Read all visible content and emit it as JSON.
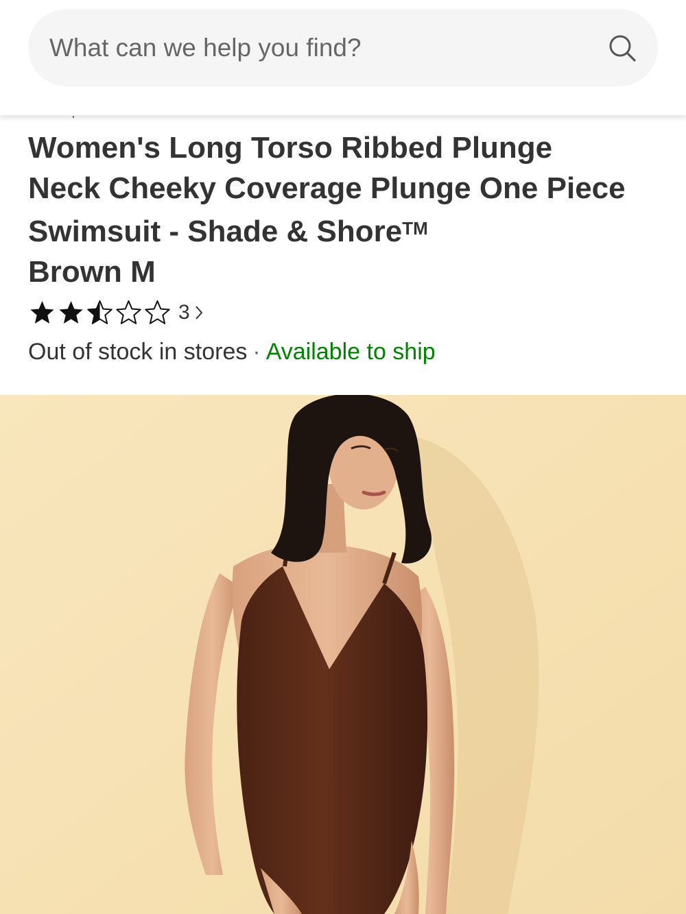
{
  "search": {
    "placeholder": "What can we help you find?",
    "icon": "search-icon"
  },
  "product": {
    "title": "Women's Long Torso Ribbed Plunge Neck Cheeky Coverage Plunge One Piece Swimsuit - Shade & Shore",
    "trademark": "TM",
    "variant": "Brown M",
    "rating": {
      "stars_filled": 2.5,
      "stars_total": 5,
      "count": "3"
    },
    "availability": {
      "in_store": "Out of stock in stores",
      "separator": "·",
      "shipping": "Available to ship"
    }
  },
  "colors": {
    "text": "#333333",
    "ship_green": "#008300",
    "search_bg": "#f5f5f5",
    "image_bg": "#f6e3b8",
    "swimsuit_brown": "#5a2a17"
  }
}
